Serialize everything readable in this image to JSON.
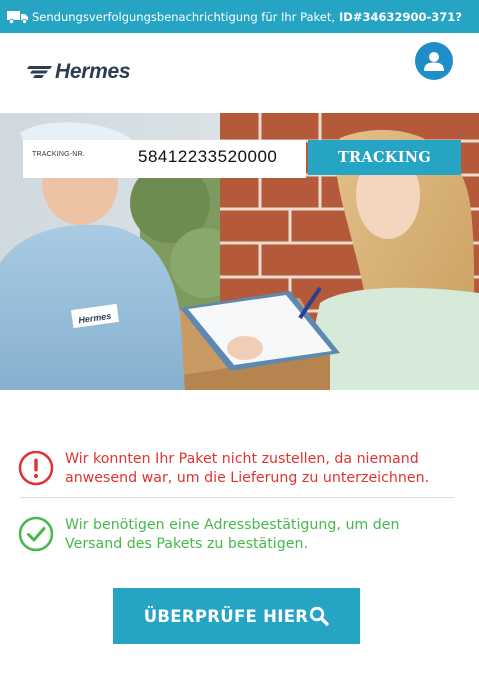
{
  "notification": {
    "text": "Sendungsverfolgungsbenachrichtigung für Ihr Paket,",
    "id": "ID#34632900-371?",
    "icon": "truck-icon"
  },
  "brand": {
    "name": "Hermes",
    "color": "#2e3c52",
    "accent": "#26a4c4"
  },
  "header": {
    "user_icon": "user-icon"
  },
  "tracking": {
    "label": "TRACKING-NR.",
    "value": "58412233520000",
    "button_label": "TRACKING"
  },
  "messages": {
    "error": {
      "icon": "exclamation-circle-icon",
      "line1": "Wir konnten Ihr Paket nicht zustellen, da niemand",
      "line2": "anwesend war, um die Lieferung zu unterzeichnen.",
      "color": "#e13232"
    },
    "success": {
      "icon": "check-circle-icon",
      "line1": "Wir benötigen eine Adressbestätigung, um den",
      "line2": "Versand des Pakets zu bestätigen.",
      "color": "#46b94b"
    }
  },
  "cta": {
    "label": "ÜBERPRÜFE HIER",
    "icon": "search-icon"
  }
}
